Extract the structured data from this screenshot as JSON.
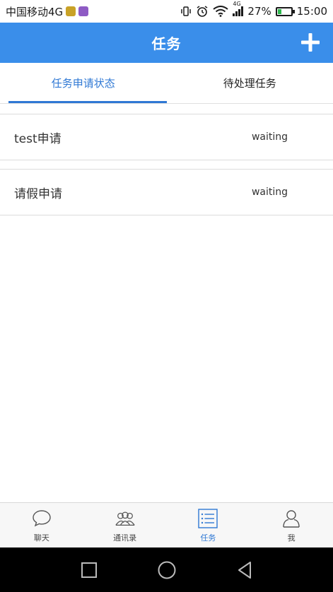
{
  "status_bar": {
    "carrier": "中国移动4G",
    "network_label": "4G",
    "battery_percent": "27%",
    "battery_level": 0.27,
    "time": "15:00"
  },
  "header": {
    "title": "任务"
  },
  "tabs": [
    {
      "label": "任务申请状态",
      "active": true
    },
    {
      "label": "待处理任务",
      "active": false
    }
  ],
  "tasks": [
    {
      "name": "test申请",
      "status": "waiting"
    },
    {
      "name": "请假申请",
      "status": "waiting"
    }
  ],
  "bottom_nav": [
    {
      "label": "聊天",
      "icon": "chat-bubble-icon",
      "active": false
    },
    {
      "label": "通讯录",
      "icon": "contacts-icon",
      "active": false
    },
    {
      "label": "任务",
      "icon": "task-list-icon",
      "active": true
    },
    {
      "label": "我",
      "icon": "person-icon",
      "active": false
    }
  ],
  "colors": {
    "primary": "#3a8eea",
    "active_tab": "#2f78d4",
    "nav_active": "#2f78d4"
  }
}
